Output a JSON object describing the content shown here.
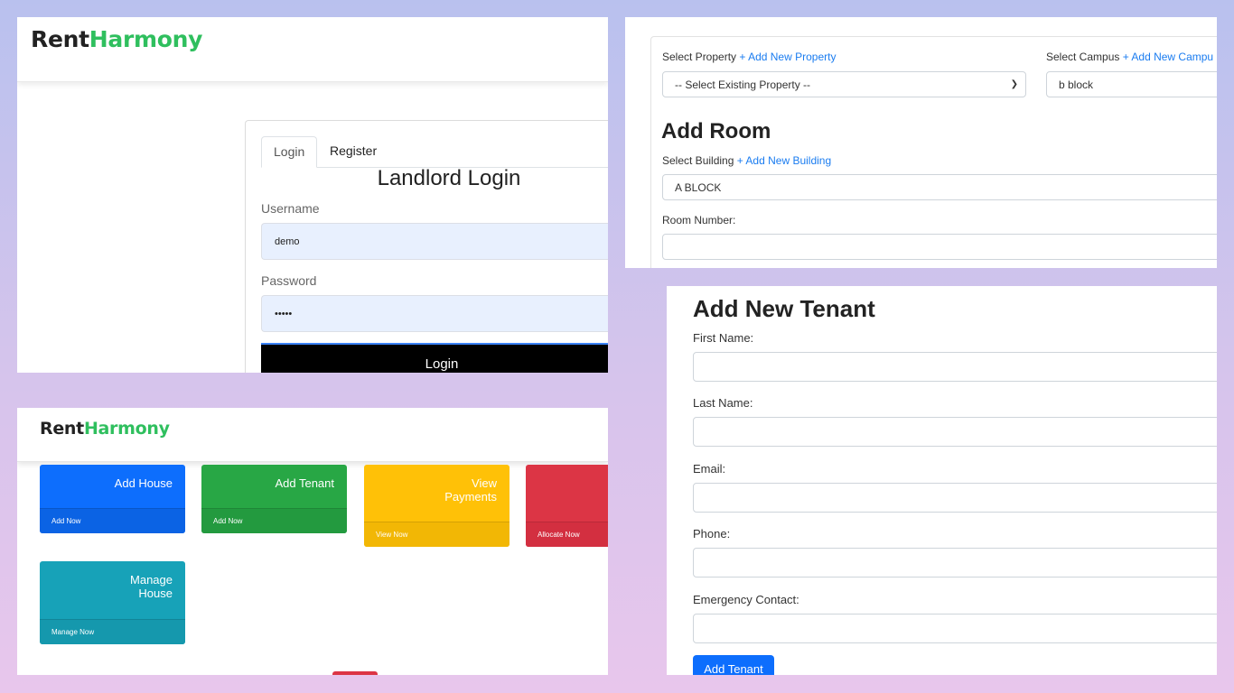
{
  "login_panel": {
    "brand_rent": "Rent",
    "brand_harmony": "Harmony",
    "tabs": [
      "Login",
      "Register"
    ],
    "title": "Landlord Login",
    "username_label": "Username",
    "username_value": "demo",
    "password_label": "Password",
    "password_value": "•••••",
    "login_button": "Login"
  },
  "dashboard_panel": {
    "brand_rent": "RentHarmony",
    "brand_rent_part": "Rent",
    "brand_harmony_part": "Harmony",
    "tiles": [
      {
        "title": "Add House",
        "footer": "Add Now",
        "color": "#0d6efd"
      },
      {
        "title": "Add Tenant",
        "footer": "Add Now",
        "color": "#28a745"
      },
      {
        "title": "View Payments",
        "title_line1": "View",
        "title_line2": "Payments",
        "footer": "View Now",
        "color": "#ffc107"
      },
      {
        "title": "",
        "footer": "Allocate Now",
        "color": "#dc3545"
      },
      {
        "title": "Manage House",
        "title_line1": "Manage",
        "title_line2": "House",
        "footer": "Manage Now",
        "color": "#17a2b8"
      }
    ]
  },
  "room_panel": {
    "select_property_label": "Select Property",
    "add_property_link": "+ Add New Property",
    "select_property_value": "-- Select Existing Property --",
    "select_campus_label": "Select Campus",
    "add_campus_link": "+ Add New Campu",
    "select_campus_value": "b block",
    "title": "Add Room",
    "select_building_label": "Select Building",
    "add_building_link": "+ Add New Building",
    "select_building_value": "A BLOCK",
    "room_number_label": "Room Number:"
  },
  "tenant_panel": {
    "title": "Add New Tenant",
    "fields": [
      "First Name:",
      "Last Name:",
      "Email:",
      "Phone:",
      "Emergency Contact:"
    ],
    "submit_button": "Add Tenant"
  },
  "colors": {
    "brand_green": "#2fbf5e",
    "primary_blue": "#0d6efd",
    "link_blue": "#1a7cf0"
  }
}
